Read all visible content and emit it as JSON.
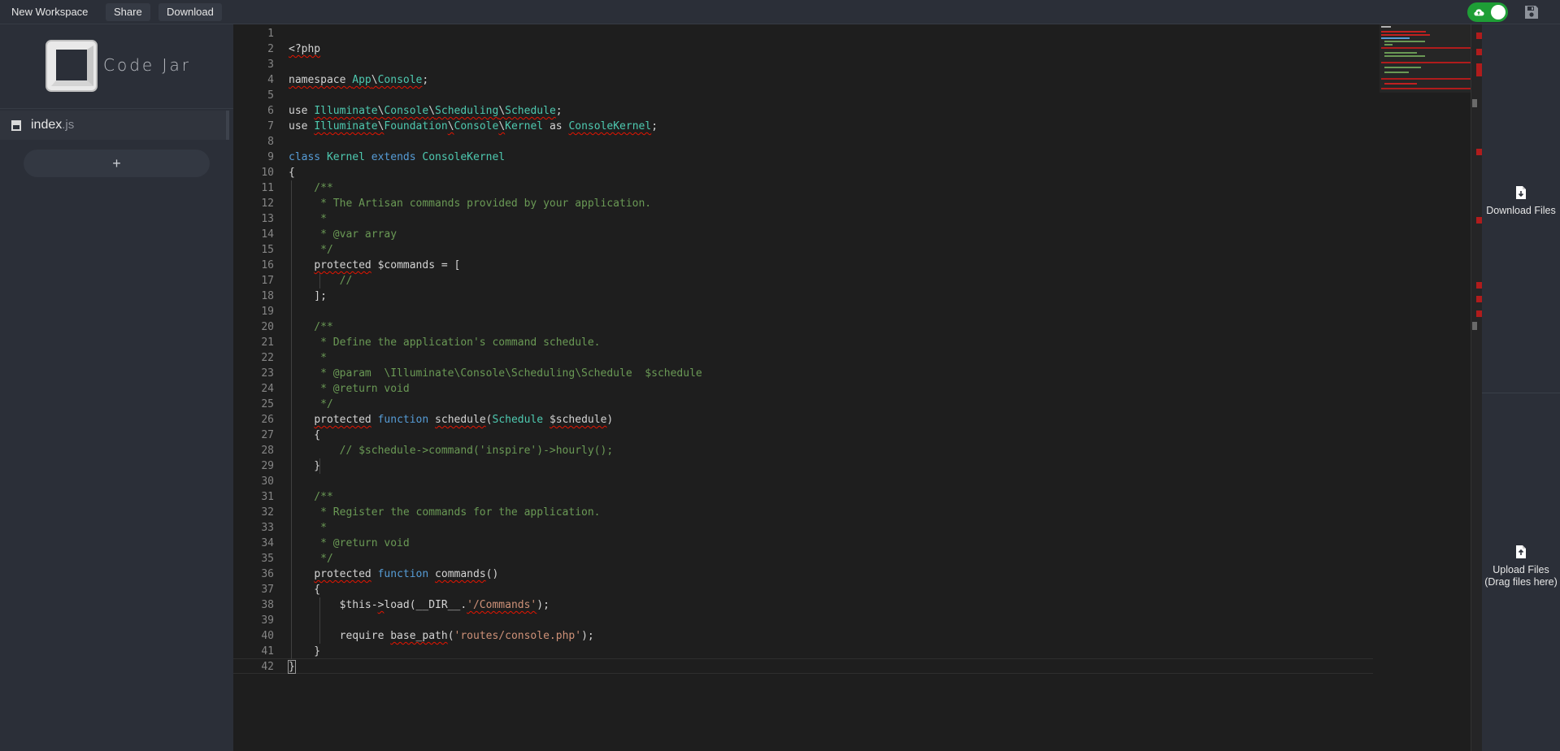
{
  "topbar": {
    "new_workspace": "New Workspace",
    "share": "Share",
    "download": "Download"
  },
  "sync_toggle": {
    "state": "on",
    "icon": "cloud-upload-icon",
    "color": "#1e9e36"
  },
  "save_icon": "save-icon",
  "brand": {
    "name": "Code Jar"
  },
  "files": [
    {
      "name": "index",
      "ext": ".js",
      "icon": "js-file-icon"
    }
  ],
  "add_file_label": "+",
  "editor": {
    "line_numbers": [
      "1",
      "2",
      "3",
      "4",
      "5",
      "6",
      "7",
      "8",
      "9",
      "10",
      "11",
      "12",
      "13",
      "14",
      "15",
      "16",
      "17",
      "18",
      "19",
      "20",
      "21",
      "22",
      "23",
      "24",
      "25",
      "26",
      "27",
      "28",
      "29",
      "30",
      "31",
      "32",
      "33",
      "34",
      "35",
      "36",
      "37",
      "38",
      "39",
      "40",
      "41",
      "42"
    ],
    "tokens": {
      "l2_a": "<?php",
      "l4_a": "namespace ",
      "l4_b": "App",
      "l4_c": "\\",
      "l4_d": "Console",
      "l4_e": ";",
      "l6_a": "use ",
      "l6_b": "Illuminate",
      "l6_c": "\\",
      "l6_d": "Console",
      "l6_e": "\\",
      "l6_f": "Scheduling",
      "l6_g": "\\",
      "l6_h": "Schedule",
      "l6_i": ";",
      "l7_a": "use ",
      "l7_b": "Illuminate",
      "l7_c": "\\",
      "l7_d": "Foundation",
      "l7_e": "\\",
      "l7_f": "Console",
      "l7_g": "\\",
      "l7_h": "Kernel",
      "l7_i": " as ",
      "l7_j": "ConsoleKernel",
      "l7_k": ";",
      "l9_a": "class ",
      "l9_b": "Kernel ",
      "l9_c": "extends ",
      "l9_d": "ConsoleKernel",
      "l10_a": "{",
      "l11_a": "    /**",
      "l12_a": "     * The Artisan commands provided by your application.",
      "l13_a": "     *",
      "l14_a": "     * @var array",
      "l15_a": "     */",
      "l16_a": "    ",
      "l16_b": "protected",
      "l16_c": " $commands = [",
      "l17_a": "        //",
      "l18_a": "    ];",
      "l20_a": "    /**",
      "l21_a": "     * Define the application's command schedule.",
      "l22_a": "     *",
      "l23_a": "     * @param  \\Illuminate\\Console\\Scheduling\\Schedule  $schedule",
      "l24_a": "     * @return void",
      "l25_a": "     */",
      "l26_a": "    ",
      "l26_b": "protected",
      "l26_c": " ",
      "l26_d": "function",
      "l26_e": " ",
      "l26_f": "schedule",
      "l26_g": "(",
      "l26_h": "Schedule",
      "l26_i": " ",
      "l26_j": "$schedule",
      "l26_k": ")",
      "l27_a": "    {",
      "l28_a": "        // $schedule->command('inspire')->hourly();",
      "l29_a": "    }",
      "l31_a": "    /**",
      "l32_a": "     * Register the commands for the application.",
      "l33_a": "     *",
      "l34_a": "     * @return void",
      "l35_a": "     */",
      "l36_a": "    ",
      "l36_b": "protected",
      "l36_c": " ",
      "l36_d": "function",
      "l36_e": " ",
      "l36_f": "commands",
      "l36_g": "()",
      "l37_a": "    {",
      "l38_a": "        $this-",
      "l38_b": ">",
      "l38_c": "load(__DIR__.",
      "l38_d": "'/Commands'",
      "l38_e": ");",
      "l40_a": "        require ",
      "l40_b": "base_path",
      "l40_c": "(",
      "l40_d": "'routes/console.php'",
      "l40_e": ");",
      "l41_a": "    }",
      "l42_a": "}"
    }
  },
  "right_panel": {
    "download_files": "Download Files",
    "download_icon": "file-download-icon",
    "upload_files": "Upload Files",
    "upload_hint": "(Drag files here)",
    "upload_icon": "file-upload-icon"
  },
  "colors": {
    "keyword": "#569cd6",
    "type": "#4ec9b0",
    "comment": "#6a9955",
    "string": "#ce9178",
    "error_squiggle": "#e51400",
    "panel_bg": "#2b2f38",
    "editor_bg": "#1e1e1e"
  }
}
